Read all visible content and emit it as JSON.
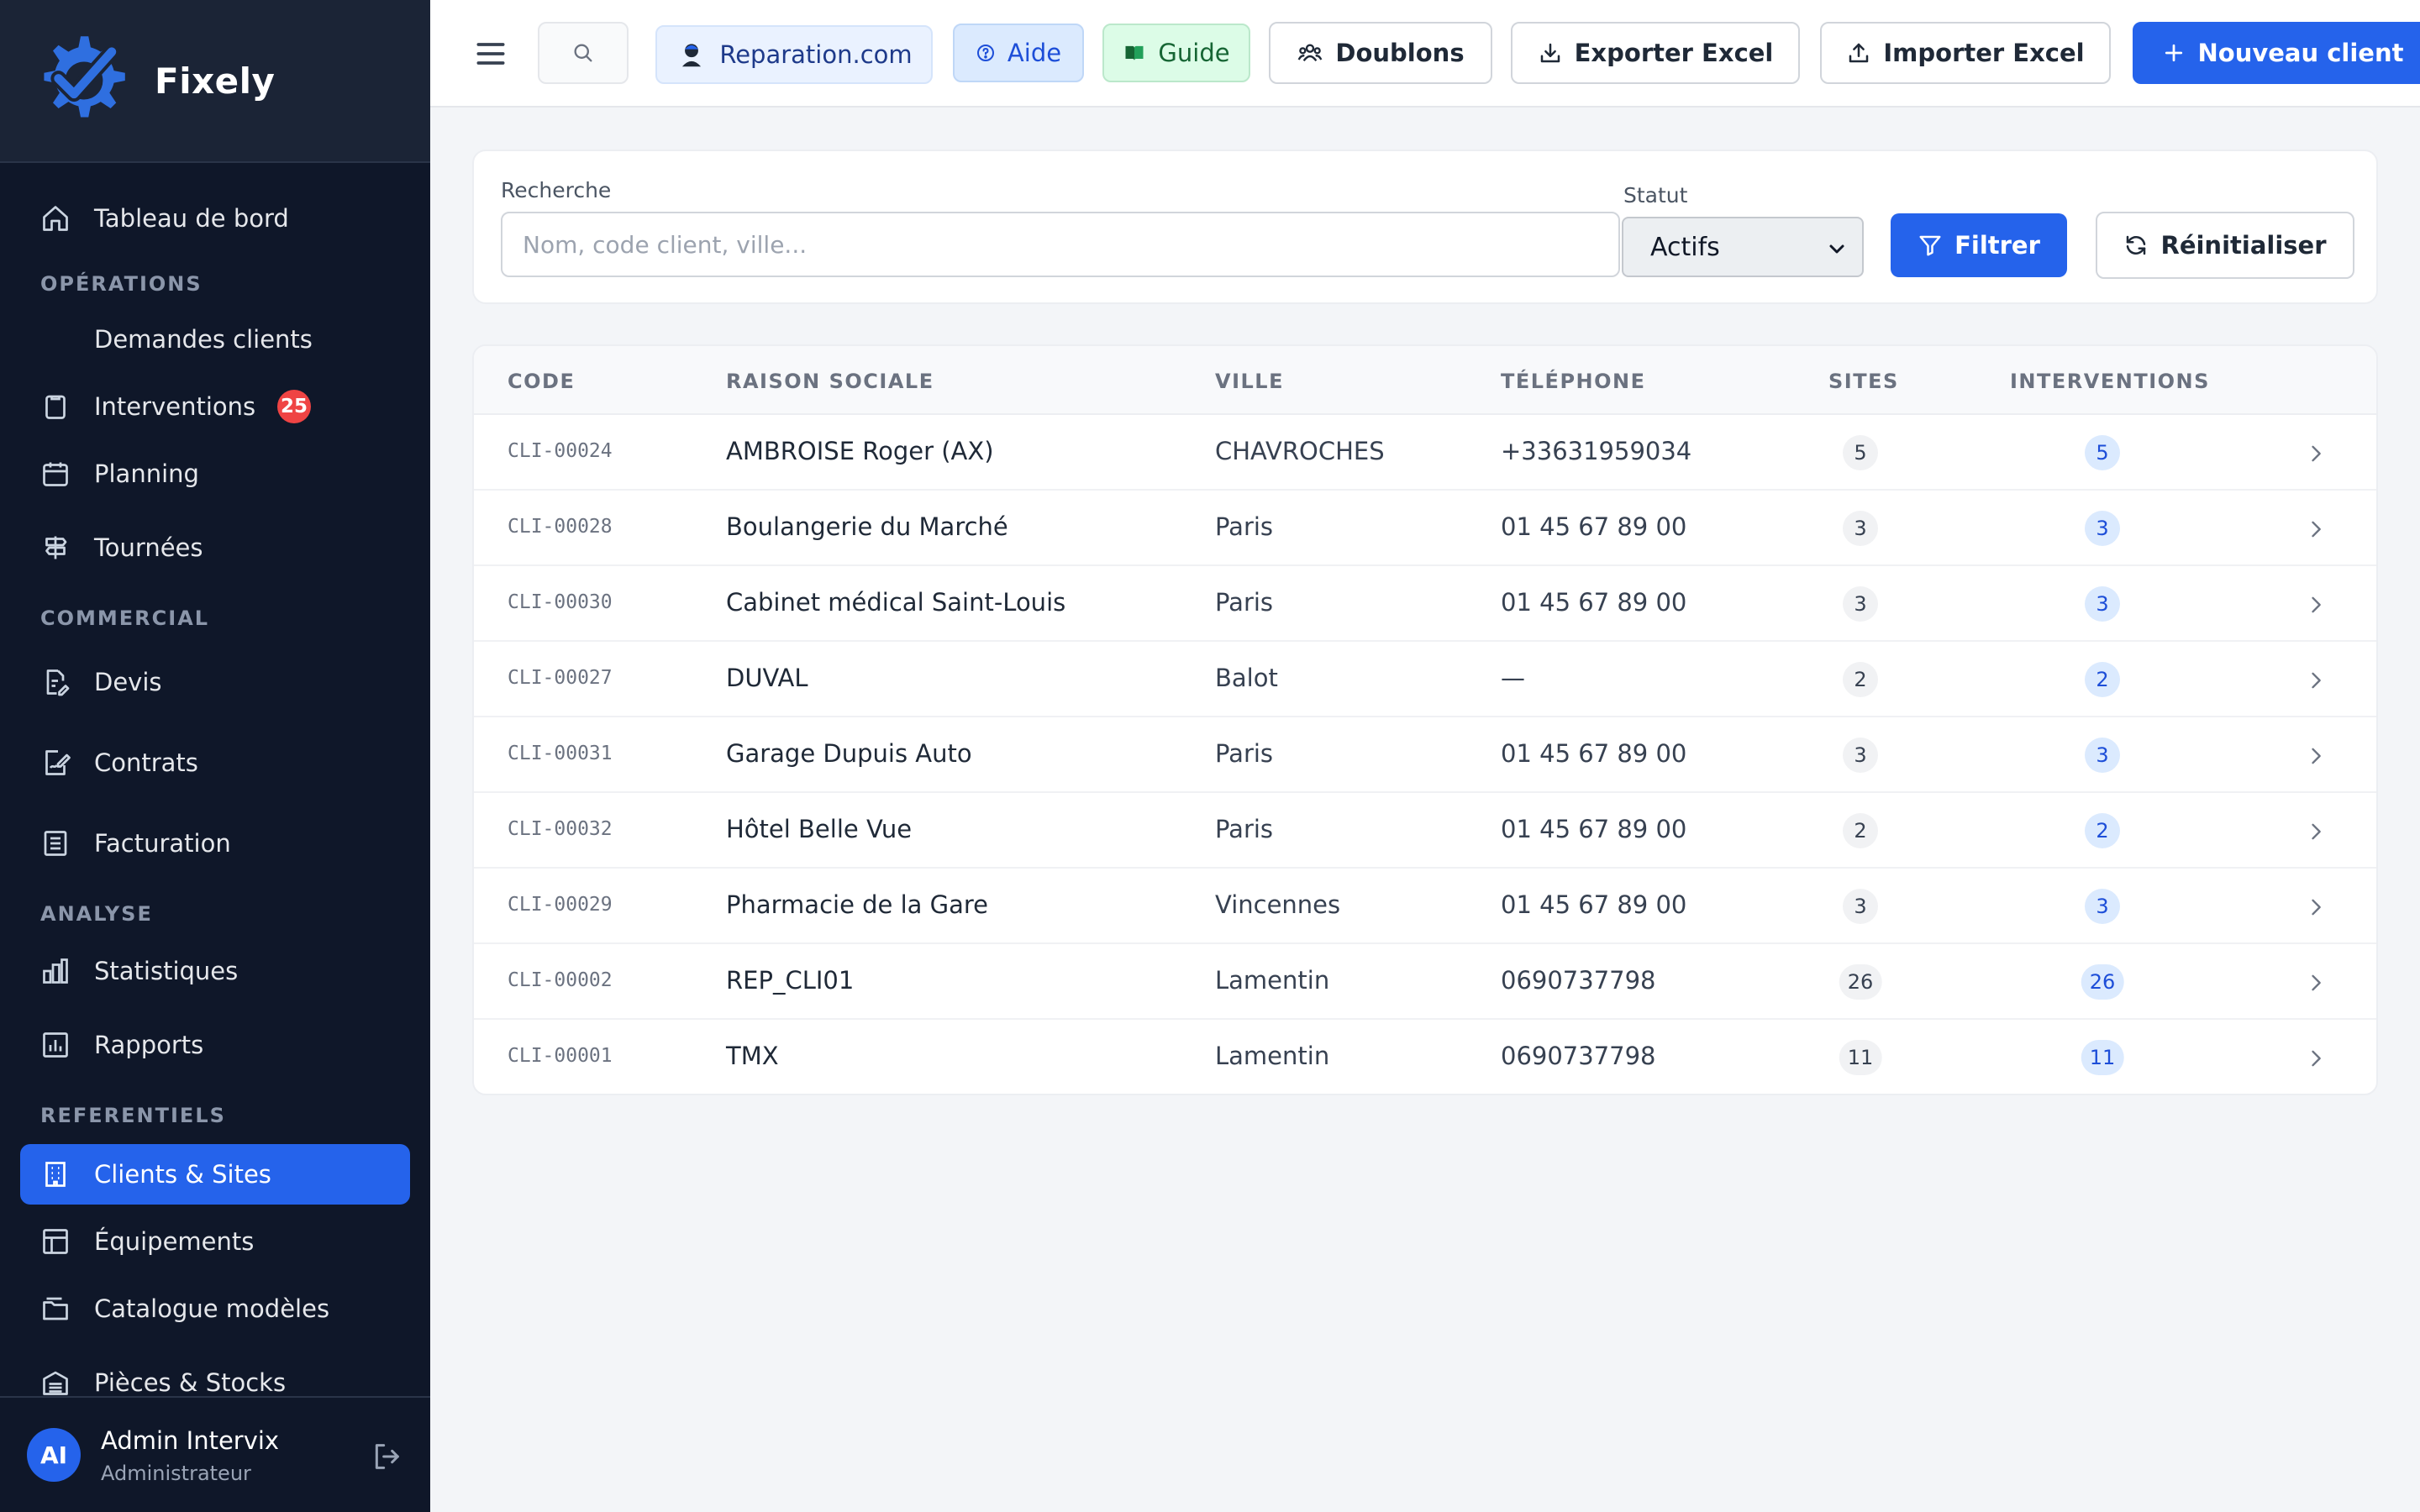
{
  "brand": {
    "name": "Fixely"
  },
  "sidebar": {
    "items": [
      {
        "key": "dashboard",
        "label": "Tableau de bord"
      },
      {
        "key": "section-operations",
        "label": "OPÉRATIONS"
      },
      {
        "key": "demandes",
        "label": "Demandes clients"
      },
      {
        "key": "interventions",
        "label": "Interventions",
        "badge": "25"
      },
      {
        "key": "planning",
        "label": "Planning"
      },
      {
        "key": "tournees",
        "label": "Tournées"
      },
      {
        "key": "section-commercial",
        "label": "COMMERCIAL"
      },
      {
        "key": "devis",
        "label": "Devis"
      },
      {
        "key": "contrats",
        "label": "Contrats"
      },
      {
        "key": "facturation",
        "label": "Facturation"
      },
      {
        "key": "section-analyse",
        "label": "ANALYSE"
      },
      {
        "key": "statistiques",
        "label": "Statistiques"
      },
      {
        "key": "rapports",
        "label": "Rapports"
      },
      {
        "key": "section-referentiels",
        "label": "REFERENTIELS"
      },
      {
        "key": "clients",
        "label": "Clients & Sites",
        "active": true
      },
      {
        "key": "equipements",
        "label": "Équipements"
      },
      {
        "key": "catalogue",
        "label": "Catalogue modèles"
      },
      {
        "key": "pieces",
        "label": "Pièces & Stocks"
      }
    ],
    "accent_color": "#2563eb",
    "badge_color": "#ef4444"
  },
  "user": {
    "initials": "AI",
    "name": "Admin Intervix",
    "role": "Administrateur"
  },
  "toolbar": {
    "reparation_label": "Reparation.com",
    "aide_label": "Aide",
    "guide_label": "Guide",
    "doublons_label": "Doublons",
    "export_label": "Exporter Excel",
    "import_label": "Importer Excel",
    "new_client_label": "Nouveau client"
  },
  "filters": {
    "search_label": "Recherche",
    "search_placeholder": "Nom, code client, ville...",
    "search_value": "",
    "status_label": "Statut",
    "status_value": "Actifs",
    "filter_button": "Filtrer",
    "reset_button": "Réinitialiser"
  },
  "table": {
    "columns": [
      "CODE",
      "RAISON SOCIALE",
      "VILLE",
      "TÉLÉPHONE",
      "SITES",
      "INTERVENTIONS"
    ],
    "rows": [
      {
        "code": "CLI-00024",
        "name": "AMBROISE Roger (AX)",
        "city": "CHAVROCHES",
        "phone": "+33631959034",
        "sites": "5",
        "interventions": "5"
      },
      {
        "code": "CLI-00028",
        "name": "Boulangerie du Marché",
        "city": "Paris",
        "phone": "01 45 67 89 00",
        "sites": "3",
        "interventions": "3"
      },
      {
        "code": "CLI-00030",
        "name": "Cabinet médical Saint-Louis",
        "city": "Paris",
        "phone": "01 45 67 89 00",
        "sites": "3",
        "interventions": "3"
      },
      {
        "code": "CLI-00027",
        "name": "DUVAL",
        "city": "Balot",
        "phone": "—",
        "sites": "2",
        "interventions": "2"
      },
      {
        "code": "CLI-00031",
        "name": "Garage Dupuis Auto",
        "city": "Paris",
        "phone": "01 45 67 89 00",
        "sites": "3",
        "interventions": "3"
      },
      {
        "code": "CLI-00032",
        "name": "Hôtel Belle Vue",
        "city": "Paris",
        "phone": "01 45 67 89 00",
        "sites": "2",
        "interventions": "2"
      },
      {
        "code": "CLI-00029",
        "name": "Pharmacie de la Gare",
        "city": "Vincennes",
        "phone": "01 45 67 89 00",
        "sites": "3",
        "interventions": "3"
      },
      {
        "code": "CLI-00002",
        "name": "REP_CLI01",
        "city": "Lamentin",
        "phone": "0690737798",
        "sites": "26",
        "interventions": "26"
      },
      {
        "code": "CLI-00001",
        "name": "TMX",
        "city": "Lamentin",
        "phone": "0690737798",
        "sites": "11",
        "interventions": "11"
      }
    ]
  },
  "colors": {
    "primary": "#2563eb",
    "sidebar_bg": "#0f1729",
    "page_bg": "#f3f5f8",
    "guide_green": "#166534"
  }
}
